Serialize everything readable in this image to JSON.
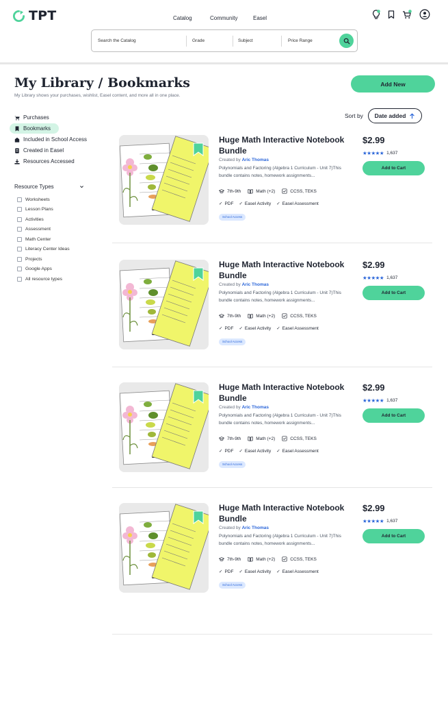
{
  "header": {
    "logo_text": "TPT",
    "nav": [
      "Catalog",
      "Community",
      "Easel"
    ],
    "search": {
      "catalog_placeholder": "Search the Catalog",
      "grade": "Grade",
      "subject": "Subject",
      "price": "Price Range"
    },
    "icons": [
      "lightbulb-icon",
      "bookmark-icon",
      "cart-icon",
      "user-icon"
    ],
    "accent_color": "#4fd39b"
  },
  "page": {
    "title": "My Library / Bookmarks",
    "subtitle": "My Library shows your purchases, wishlist, Easel content, and more all in one place.",
    "add_new": "Add New"
  },
  "sidebar": {
    "items": [
      {
        "label": "Purchases",
        "icon": "cart-icon"
      },
      {
        "label": "Bookmarks",
        "icon": "bookmark-icon",
        "active": true
      },
      {
        "label": "Included in School Access",
        "icon": "school-icon"
      },
      {
        "label": "Created in Easel",
        "icon": "easel-icon"
      },
      {
        "label": "Resources Accessed",
        "icon": "download-icon"
      }
    ],
    "resource_types_title": "Resource Types",
    "resource_types": [
      "Worksheets",
      "Lesson Plans",
      "Activities",
      "Assessment",
      "Math Center",
      "Literacy Center Ideas",
      "Projects",
      "Google Apps",
      "All resource types"
    ]
  },
  "sort": {
    "label": "Sort by",
    "value": "Date added"
  },
  "products": [
    {
      "title": "Huge Math Interactive Notebook Bundle",
      "created_by": "Created by",
      "author": "Aric Thomas",
      "description": "Polynomials and Factoring (Algebra 1 Curriculum - Unit 7)This bundle contains notes, homework assignments...",
      "grade": "7th-9th",
      "subject": "Math (+2)",
      "standards": "CCSS, TEKS",
      "features": [
        "PDF",
        "Easel Activity",
        "Easel Assessment"
      ],
      "badge": "School Access",
      "price": "$2.99",
      "rating": 4.8,
      "reviews": "1,637",
      "cart_label": "Add to Cart"
    },
    {
      "title": "Huge Math Interactive Notebook Bundle",
      "created_by": "Created by",
      "author": "Aric Thomas",
      "description": "Polynomials and Factoring (Algebra 1 Curriculum - Unit 7)This bundle contains notes, homework assignments...",
      "grade": "7th-9th",
      "subject": "Math (+2)",
      "standards": "CCSS, TEKS",
      "features": [
        "PDF",
        "Easel Activity",
        "Easel Assessment"
      ],
      "badge": "School Access",
      "price": "$2.99",
      "rating": 4.8,
      "reviews": "1,637",
      "cart_label": "Add to Cart"
    },
    {
      "title": "Huge Math Interactive Notebook Bundle",
      "created_by": "Created by",
      "author": "Aric Thomas",
      "description": "Polynomials and Factoring (Algebra 1 Curriculum - Unit 7)This bundle contains notes, homework assignments...",
      "grade": "7th-9th",
      "subject": "Math (+2)",
      "standards": "CCSS, TEKS",
      "features": [
        "PDF",
        "Easel Activity",
        "Easel Assessment"
      ],
      "badge": "School Access",
      "price": "$2.99",
      "rating": 4.8,
      "reviews": "1,637",
      "cart_label": "Add to Cart"
    },
    {
      "title": "Huge Math Interactive Notebook Bundle",
      "created_by": "Created by",
      "author": "Aric Thomas",
      "description": "Polynomials and Factoring (Algebra 1 Curriculum - Unit 7)This bundle contains notes, homework assignments...",
      "grade": "7th-9th",
      "subject": "Math (+2)",
      "standards": "CCSS, TEKS",
      "features": [
        "PDF",
        "Easel Activity",
        "Easel Assessment"
      ],
      "badge": "School Access",
      "price": "$2.99",
      "rating": 4.8,
      "reviews": "1,637",
      "cart_label": "Add to Cart"
    }
  ]
}
